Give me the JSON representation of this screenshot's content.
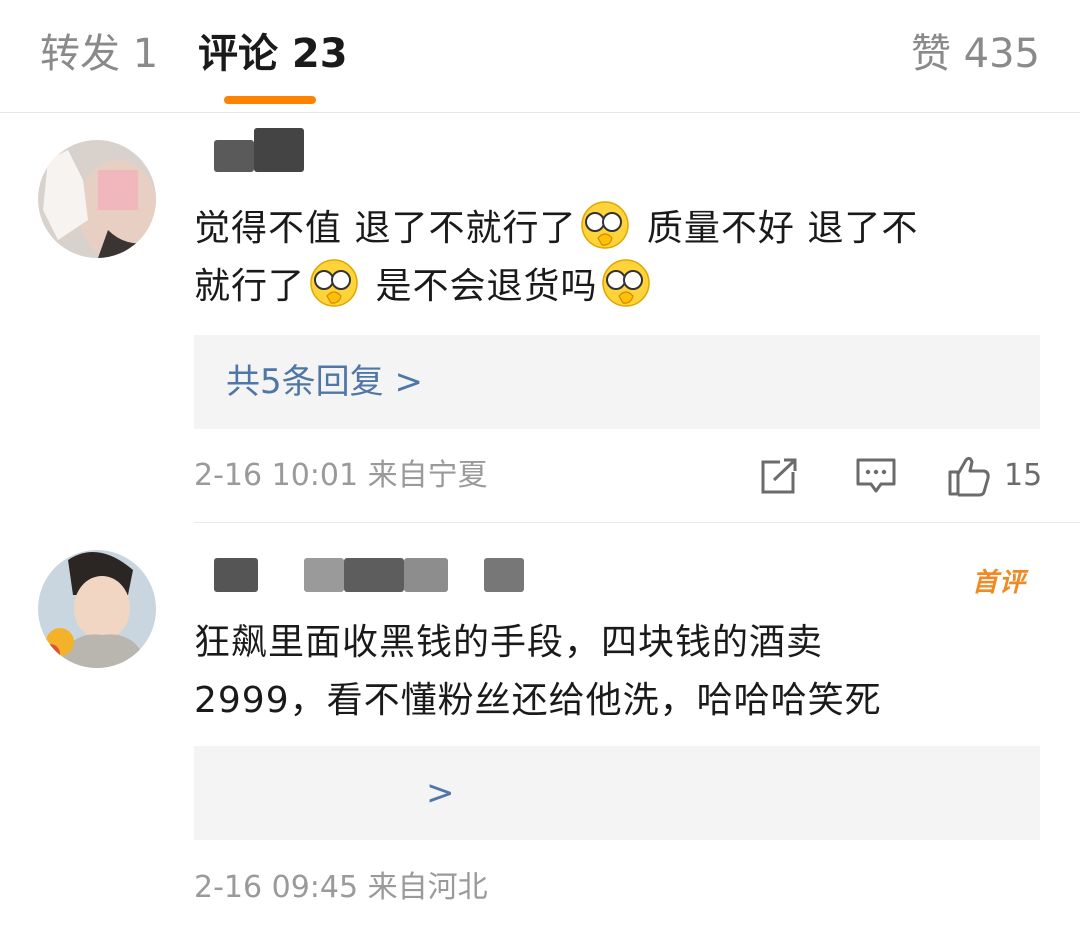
{
  "tabs": {
    "repost": "转发 1",
    "comments": "评论 23",
    "likes": "赞 435"
  },
  "comments": [
    {
      "text_line1": "觉得不值 退了不就行了",
      "text_mid1": "质量不好 退了不",
      "text_line2": "就行了",
      "text_mid2": "是不会退货吗",
      "emoji": "hand-over-eyes-emoji",
      "replies": "共5条回复 >",
      "time": "2-16 10:01",
      "location": "来自宁夏",
      "likes": "15"
    },
    {
      "badge": "首评",
      "text_line1": "狂飙里面收黑钱的手段，四块钱的酒卖",
      "text_line2": "2999，看不懂粉丝还给他洗，哈哈哈笑死",
      "replies_arrow": ">",
      "time": "2-16 09:45",
      "location": "来自河北"
    }
  ],
  "icons": {
    "share": "share-icon",
    "comment": "comment-icon",
    "like": "thumbs-up-icon"
  },
  "colors": {
    "accent": "#ff8200",
    "link": "#4e77a8",
    "badge": "#f08a24"
  }
}
